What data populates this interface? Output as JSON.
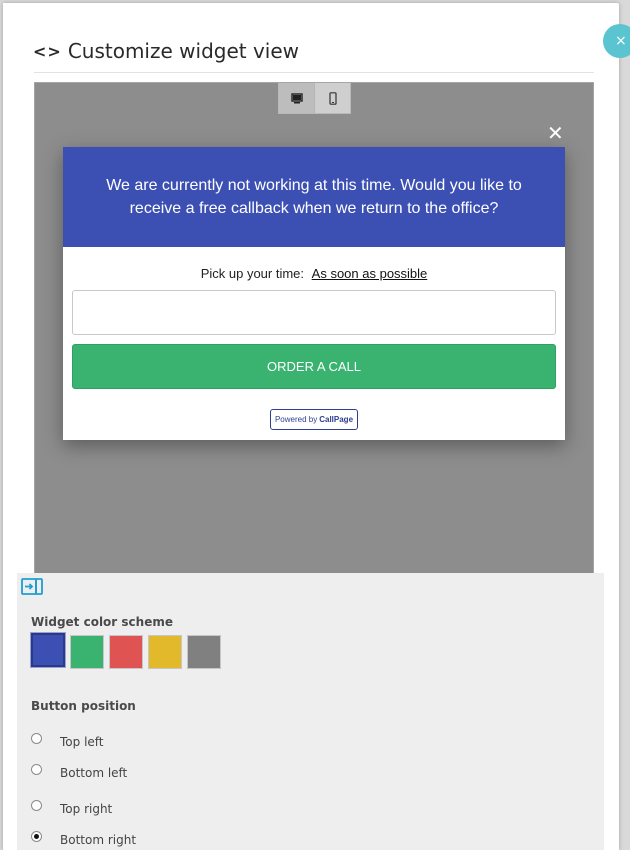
{
  "dialog": {
    "title": "Customize widget view",
    "close_symbol": "×"
  },
  "preview": {
    "devices": [
      {
        "name": "desktop-icon",
        "active": true
      },
      {
        "name": "mobile-icon",
        "active": false
      }
    ],
    "popup_close_symbol": "✕",
    "popup": {
      "message": "We are currently not working at this time. Would you like to receive a free callback when we return to the office?",
      "pickup_label": "Pick up your time:",
      "pickup_value": "As soon as possible",
      "phone_value": "",
      "order_button": "ORDER A CALL",
      "powered_prefix": "Powered by",
      "powered_brand": "CallPage"
    }
  },
  "settings": {
    "color_scheme_label": "Widget color scheme",
    "colors": [
      "#3c50b4",
      "#39b36f",
      "#e05353",
      "#e2b92a",
      "#808080"
    ],
    "selected_color": "#3c50b4",
    "button_position_label": "Button position",
    "positions": [
      {
        "label": "Top left",
        "checked": false
      },
      {
        "label": "Bottom left",
        "checked": false
      },
      {
        "label": "Top right",
        "checked": false
      },
      {
        "label": "Bottom right",
        "checked": true
      }
    ]
  },
  "colors": {
    "header_blue": "#3c50b4",
    "order_green": "#39b36f",
    "close_teal": "#5bc4d1"
  }
}
